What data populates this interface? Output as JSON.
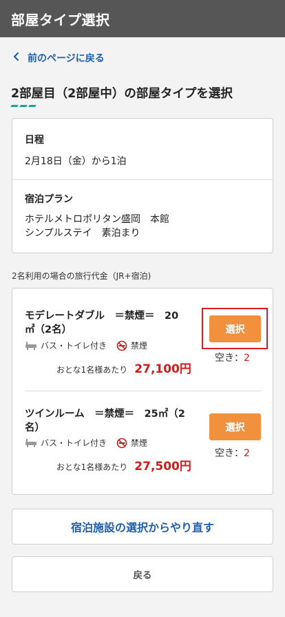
{
  "header": {
    "title": "部屋タイプ選択"
  },
  "nav": {
    "back_label": "前のページに戻る",
    "back_icon": "chevron-left-icon"
  },
  "page": {
    "title": "2部屋目（2部屋中）の部屋タイプを選択"
  },
  "info": {
    "schedule_label": "日程",
    "schedule_value": "2月18日（金）から1泊",
    "plan_label": "宿泊プラン",
    "plan_line1": "ホテルメトロポリタン盛岡　本館",
    "plan_line2": "シンプルステイ　素泊まり"
  },
  "price_note": "2名利用の場合の旅行代金（JR+宿泊)",
  "rooms": [
    {
      "name_line1": "モデレートダブル　＝禁煙＝　20",
      "name_line2": "㎡（2名）",
      "amenity_bath": "バス・トイレ付き",
      "amenity_smoke": "禁煙",
      "price_label": "おとな1名様あたり",
      "price": "27,100円",
      "select_label": "選択",
      "avail_label": "空き：",
      "avail_count": "2"
    },
    {
      "name_line1": "ツインルーム　＝禁煙＝　25㎡（2",
      "name_line2": "名）",
      "amenity_bath": "バス・トイレ付き",
      "amenity_smoke": "禁煙",
      "price_label": "おとな1名様あたり",
      "price": "27,500円",
      "select_label": "選択",
      "avail_label": "空き：",
      "avail_count": "2"
    }
  ],
  "actions": {
    "redo_label": "宿泊施設の選択からやり直す",
    "back_label": "戻る"
  },
  "colors": {
    "header_bg": "#565656",
    "link": "#1f5fae",
    "accent_teal": "#1aa197",
    "select_button": "#f2913d",
    "price": "#d21a1a",
    "highlight": "#e01b24"
  }
}
